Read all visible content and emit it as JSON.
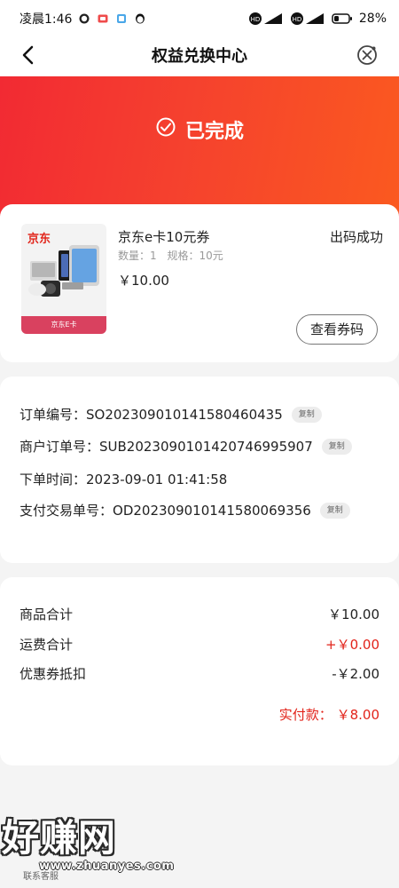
{
  "status_bar": {
    "time": "凌晨1:46",
    "battery": "28%"
  },
  "header": {
    "title": "权益兑换中心"
  },
  "hero": {
    "status_text": "已完成"
  },
  "product": {
    "brand_label": "京东",
    "image_caption": "京东E卡",
    "name": "京东e卡10元券",
    "quantity": "数量：1",
    "spec": "规格：10元",
    "price": "￥10.00",
    "status": "出码成功",
    "view_code_label": "查看券码"
  },
  "order": {
    "rows": [
      {
        "label": "订单编号：",
        "value": "SO202309010141580460435",
        "copy": "复制"
      },
      {
        "label": "商户订单号：",
        "value": "SUB20230901014207469959​07",
        "copy": "复制"
      },
      {
        "label": "下单时间：",
        "value": "2023-09-01 01:41:58",
        "copy": ""
      },
      {
        "label": "支付交易单号：",
        "value": "OD202309010141580069356",
        "copy": "复制"
      }
    ]
  },
  "summary": {
    "goods_total_label": "商品合计",
    "goods_total_value": "￥10.00",
    "shipping_label": "运费合计",
    "shipping_value": "+￥0.00",
    "coupon_label": "优惠券抵扣",
    "coupon_value": "-￥2.00",
    "paid_label": "实付款：",
    "paid_value": "￥8.00"
  },
  "watermark": {
    "main": "好赚网",
    "url": "www.zhuanyes.com",
    "service": "联系客服"
  },
  "colors": {
    "accent": "#e2231a",
    "hero_start": "#f22a33",
    "hero_end": "#fb5a1f"
  }
}
